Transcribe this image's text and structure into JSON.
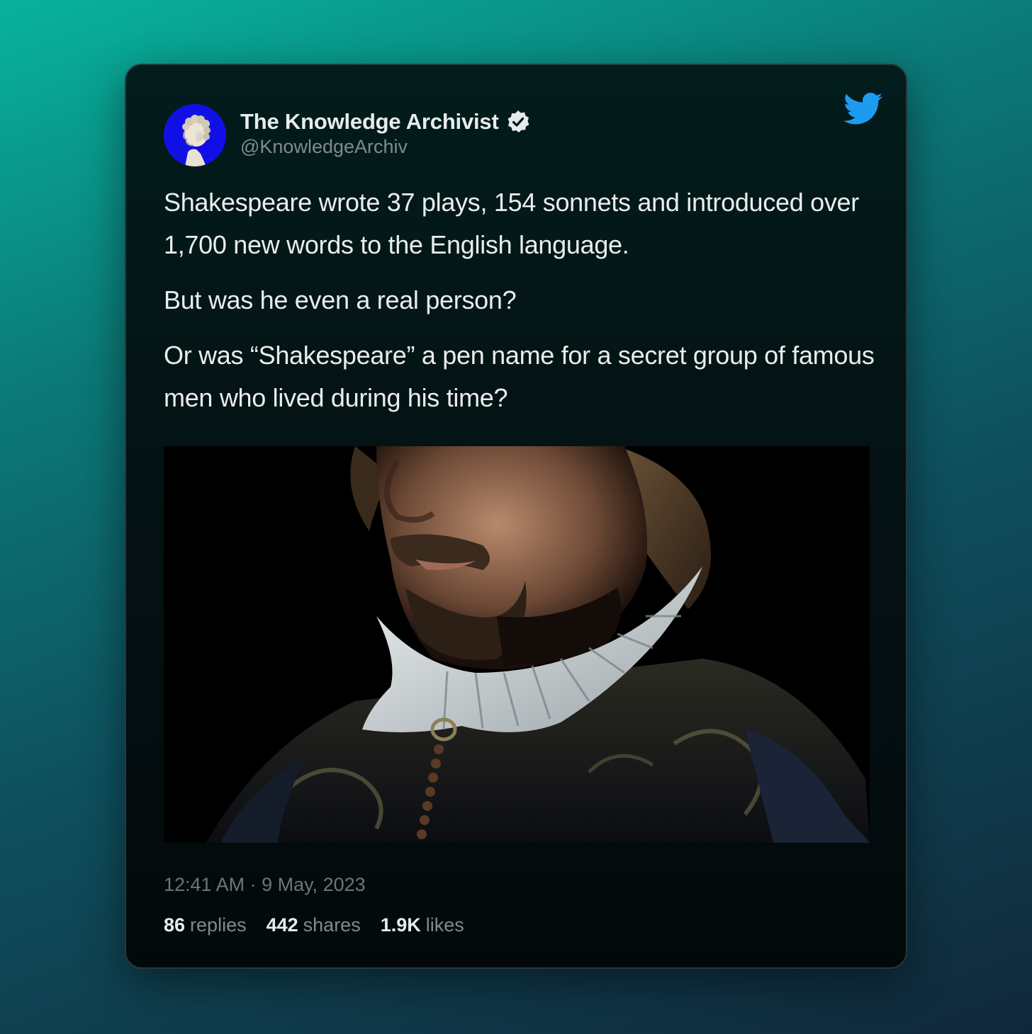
{
  "tweet": {
    "author": {
      "display_name": "The Knowledge Archivist",
      "handle": "@KnowledgeArchiv",
      "verified": true,
      "avatar_icon": "marble-bust-avatar",
      "avatar_bg": "#1010e6"
    },
    "brand_icon": "twitter-bird-icon",
    "brand_color": "#1d9bf0",
    "paragraphs": [
      "Shakespeare wrote 37 plays, 154 sonnets and introduced over 1,700 new words to the English language.",
      "But was he even a real person?",
      "Or was “Shakespeare” a pen name for a secret group of famous men who lived during his time?"
    ],
    "image": {
      "subject": "portrait-shakespeare-ruff-collar"
    },
    "timestamp": "12:41 AM · 9 May, 2023",
    "stats": {
      "replies": {
        "count": "86",
        "label": "replies"
      },
      "shares": {
        "count": "442",
        "label": "shares"
      },
      "likes": {
        "count": "1.9K",
        "label": "likes"
      }
    }
  }
}
